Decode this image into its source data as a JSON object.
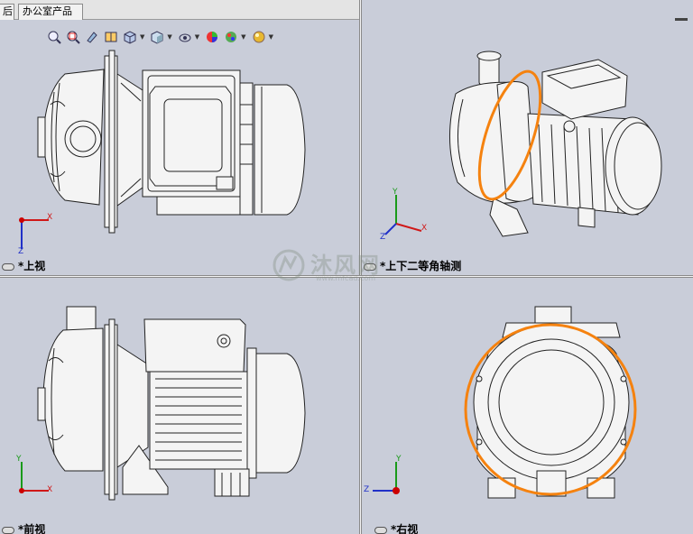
{
  "tabs": [
    {
      "label": "后"
    },
    {
      "label": "办公室产品"
    }
  ],
  "views": {
    "top": "*上视",
    "iso": "*上下二等角轴测",
    "front": "*前视",
    "right": "*右视"
  },
  "triad": {
    "x": "X",
    "y": "Y",
    "z": "Z"
  },
  "watermark": {
    "text": "沐风网",
    "url": "www.mfcad.com"
  },
  "toolbar": {
    "icons": [
      "zoom-to-fit-icon",
      "zoom-area-icon",
      "previous-view-icon",
      "section-view-icon",
      "view-orientation-icon",
      "display-style-icon",
      "hide-show-icon",
      "edit-appearance-icon",
      "apply-scene-icon",
      "view-settings-icon"
    ]
  },
  "colors": {
    "background": "#c9cdd9",
    "highlight": "#f5820f",
    "triad_x": "#d01818",
    "triad_y": "#1a9a1a",
    "triad_z": "#2030c8"
  }
}
